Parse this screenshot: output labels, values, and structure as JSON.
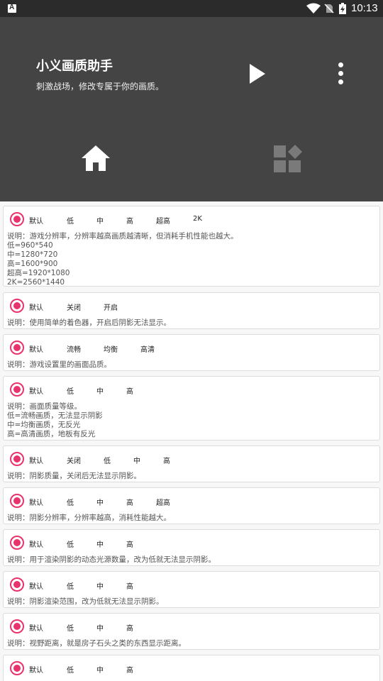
{
  "status_bar": {
    "time": "10:13",
    "icons": [
      "a-icon",
      "wifi-icon",
      "no-sim-icon",
      "battery-charging-icon"
    ]
  },
  "header": {
    "title": "小义画质助手",
    "subtitle": "刺激战场，修改专属于你的画质。",
    "icons": [
      "play-icon",
      "more-vert-icon",
      "home-icon",
      "apps-icon"
    ]
  },
  "accent_color": "#e8336d",
  "settings": [
    {
      "options": [
        "默认",
        "低",
        "中",
        "高",
        "超高",
        "2K"
      ],
      "selected": 0,
      "description": [
        "说明：游戏分辨率，分辨率越高画质越清晰，但消耗手机性能也越大。",
        "低=960*540",
        "中=1280*720",
        "高=1600*900",
        "超高=1920*1080",
        "2K=2560*1440"
      ]
    },
    {
      "options": [
        "默认",
        "关闭",
        "开启"
      ],
      "selected": 0,
      "description": [
        "说明：使用简单的着色器，开启后阴影无法显示。"
      ]
    },
    {
      "options": [
        "默认",
        "流畅",
        "均衡",
        "高清"
      ],
      "selected": 0,
      "description": [
        "说明：游戏设置里的画面品质。"
      ]
    },
    {
      "options": [
        "默认",
        "低",
        "中",
        "高"
      ],
      "selected": 0,
      "description": [
        "说明：画面质量等级。",
        "低=流畅画质，无法显示阴影",
        "中=均衡画质，无反光",
        "高=高清画质，地板有反光"
      ]
    },
    {
      "options": [
        "默认",
        "关闭",
        "低",
        "中",
        "高"
      ],
      "selected": 0,
      "description": [
        "说明：阴影质量，关闭后无法显示阴影。"
      ]
    },
    {
      "options": [
        "默认",
        "低",
        "中",
        "高",
        "超高"
      ],
      "selected": 0,
      "description": [
        "说明：阴影分辨率，分辨率越高，消耗性能越大。"
      ]
    },
    {
      "options": [
        "默认",
        "低",
        "中",
        "高"
      ],
      "selected": 0,
      "description": [
        "说明：用于渲染阴影的动态光源数量，改为低就无法显示阴影。"
      ]
    },
    {
      "options": [
        "默认",
        "低",
        "中",
        "高"
      ],
      "selected": 0,
      "description": [
        "说明：阴影渲染范围，改为低就无法显示阴影。"
      ]
    },
    {
      "options": [
        "默认",
        "低",
        "中",
        "高"
      ],
      "selected": 0,
      "description": [
        "说明：视野距离，就是房子石头之类的东西显示距离。"
      ]
    },
    {
      "options": [
        "默认",
        "低",
        "中",
        "高"
      ],
      "selected": 0,
      "description": [
        ""
      ]
    }
  ]
}
